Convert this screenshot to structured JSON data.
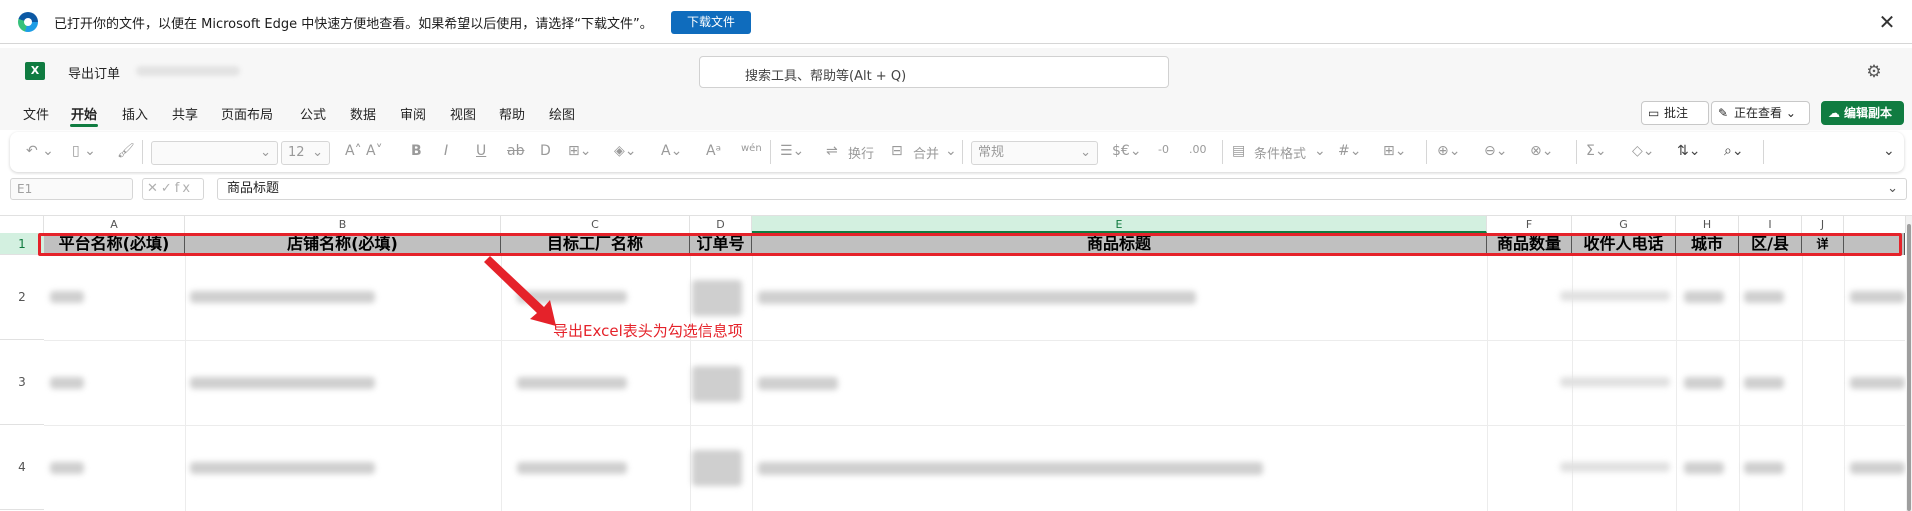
{
  "infobar": {
    "message": "已打开你的文件，以便在 Microsoft Edge 中快速方便地查看。如果希望以后使用，请选择“下载文件”。",
    "download_label": "下载文件",
    "close_glyph": "✕"
  },
  "app": {
    "logo_letter": "X",
    "title": "导出订单",
    "search_placeholder": "搜索工具、帮助等(Alt + Q)",
    "settings_glyph": "⚙"
  },
  "ribbon": {
    "tabs": [
      "文件",
      "开始",
      "插入",
      "共享",
      "页面布局",
      "公式",
      "数据",
      "审阅",
      "视图",
      "帮助",
      "绘图"
    ],
    "active_tab": "开始",
    "comment_label": "批注",
    "viewing_label": "正在查看",
    "edit_label": "编辑副本",
    "font_size": "12",
    "wrap_label": "换行",
    "merge_label": "合并",
    "number_format": "常规",
    "conditional_format_label": "条件格式"
  },
  "formula_bar": {
    "cell_ref": "E1",
    "fx_icons": "✕✓fx",
    "content": "商品标题"
  },
  "grid": {
    "columns": [
      "A",
      "B",
      "C",
      "D",
      "E",
      "F",
      "G",
      "H",
      "I",
      "J"
    ],
    "selected_column": "E",
    "rows": [
      "1",
      "2",
      "3",
      "4"
    ],
    "selected_row": "1",
    "header_cells": [
      "平台名称(必填)",
      "店铺名称(必填)",
      "目标工厂名称",
      "订单号",
      "商品标题",
      "商品数量",
      "收件人电话",
      "城市",
      "区/县",
      "详"
    ]
  },
  "annotation": {
    "text": "导出Excel表头为勾选信息项",
    "color": "#e5222a"
  },
  "colors": {
    "excel_green": "#107c41",
    "edge_blue": "#0f6cbd",
    "header_fill": "#c0c0c0"
  }
}
